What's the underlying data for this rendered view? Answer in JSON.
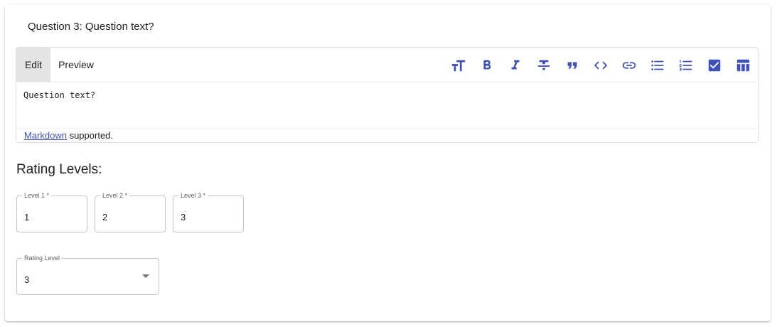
{
  "question": {
    "title": "Question 3: Question text?"
  },
  "editor": {
    "tabs": {
      "edit": "Edit",
      "preview": "Preview"
    },
    "active_tab": "Edit",
    "toolbar": [
      "text-size-icon",
      "bold-icon",
      "italic-icon",
      "strikethrough-icon",
      "quote-icon",
      "code-icon",
      "link-icon",
      "bulleted-list-icon",
      "numbered-list-icon",
      "checkbox-icon",
      "table-icon"
    ],
    "content": "Question text?",
    "footer": {
      "link": "Markdown",
      "suffix": " supported."
    }
  },
  "rating_levels": {
    "title": "Rating Levels:",
    "levels": [
      {
        "label": "Level 1 *",
        "value": "1"
      },
      {
        "label": "Level 2 *",
        "value": "2"
      },
      {
        "label": "Level 3 *",
        "value": "3"
      }
    ]
  },
  "rating_level_select": {
    "label": "Rating Level",
    "value": "3"
  },
  "colors": {
    "accent": "#3f51b5",
    "active_tab_bg": "#e4e4e4",
    "border": "#c4c4c4"
  }
}
